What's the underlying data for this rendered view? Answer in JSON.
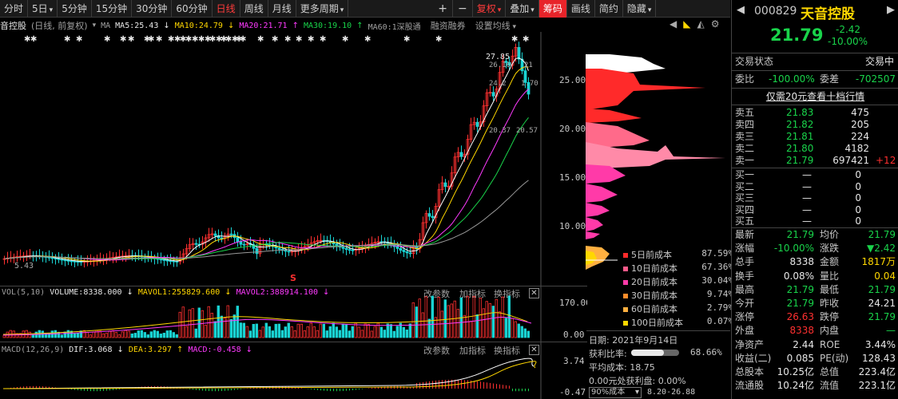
{
  "toolbar": {
    "items": [
      "分时",
      "5日",
      "5分钟",
      "15分钟",
      "30分钟",
      "60分钟",
      "日线",
      "周线",
      "月线",
      "更多周期"
    ],
    "active": "日线",
    "plus": "+",
    "minus": "−",
    "fuquan": "复权",
    "diejia": "叠加",
    "chouma": "筹码",
    "huaxian": "画线",
    "jianyue": "简约",
    "yincang": "隐藏",
    "nav_left": "◀",
    "nav_right": "▶"
  },
  "chart_header": {
    "name": "音控股",
    "mode": "(日线, 前复权)",
    "ma_label": "MA",
    "ma5": "MA5:25.43",
    "ma10": "MA10:24.79",
    "ma20": "MA20:21.71",
    "ma30": "MA30:19.10",
    "ma60": "MA60:1深股通",
    "rongzi": "融资融券",
    "settings": "设置均线"
  },
  "price_axis": [
    "25.00",
    "20.00",
    "15.00",
    "10.00"
  ],
  "price_annotations": {
    "high": "27.85",
    "a1": "26.16",
    "a2": "21",
    "a3": "24.2",
    "a4": "1.70",
    "a5": "20.37",
    "a6": "20.57",
    "low": "5.43",
    "s_marker": "S"
  },
  "volume_panel": {
    "label": "VOL(5,10)",
    "volume": "VOLUME:8338.000",
    "mavol1": "MAVOL1:255829.600",
    "mavol2": "MAVOL2:388914.100",
    "btn_params": "改参数",
    "btn_add": "加指标",
    "btn_switch": "换指标",
    "axis": [
      "170.00",
      "0.00"
    ]
  },
  "macd_panel": {
    "label": "MACD(12,26,9)",
    "dif": "DIF:3.068",
    "dea": "DEA:3.297",
    "macd": "MACD:-0.458",
    "btn_params": "改参数",
    "btn_add": "加指标",
    "btn_switch": "换指标",
    "axis": [
      "3.74",
      "-0.47"
    ]
  },
  "cost": {
    "legend": [
      {
        "label": "5日前成本",
        "pct": "87.59%",
        "color": "#ff2a2a"
      },
      {
        "label": "10日前成本",
        "pct": "67.36%",
        "color": "#ff5a8a"
      },
      {
        "label": "20日前成本",
        "pct": "30.04%",
        "color": "#ff3aa8"
      },
      {
        "label": "30日前成本",
        "pct": "9.74%",
        "color": "#ff8c2a"
      },
      {
        "label": "60日前成本",
        "pct": "2.79%",
        "color": "#ffb040"
      },
      {
        "label": "100日前成本",
        "pct": "0.07%",
        "color": "#ffd700"
      }
    ],
    "date_label": "日期: 2021年9月14日",
    "profit_label": "获利比率:",
    "profit_pct": "68.66%",
    "avg_label": "平均成本: 18.75",
    "profit_price": "0.00元处获利盘: 0.00%",
    "range_select": "90%成本",
    "range_value": "8.20-26.88"
  },
  "quote": {
    "code": "000829",
    "name": "天音控股",
    "price": "21.79",
    "change": "-2.42",
    "change_pct": "-10.00%",
    "status_label": "交易状态",
    "status_value": "交易中",
    "weibi_label": "委比",
    "weibi_value": "-100.00%",
    "weicha_label": "委差",
    "weicha_value": "-702507",
    "promo": "仅需20元查看十档行情",
    "sells": [
      {
        "label": "卖五",
        "price": "21.83",
        "vol": "475",
        "extra": ""
      },
      {
        "label": "卖四",
        "price": "21.82",
        "vol": "205",
        "extra": ""
      },
      {
        "label": "卖三",
        "price": "21.81",
        "vol": "224",
        "extra": ""
      },
      {
        "label": "卖二",
        "price": "21.80",
        "vol": "4182",
        "extra": ""
      },
      {
        "label": "卖一",
        "price": "21.79",
        "vol": "697421",
        "extra": "+12"
      }
    ],
    "buys": [
      {
        "label": "买一",
        "price": "—",
        "vol": "0"
      },
      {
        "label": "买二",
        "price": "—",
        "vol": "0"
      },
      {
        "label": "买三",
        "price": "—",
        "vol": "0"
      },
      {
        "label": "买四",
        "price": "—",
        "vol": "0"
      },
      {
        "label": "买五",
        "price": "—",
        "vol": "0"
      }
    ],
    "stats": [
      {
        "l1": "最新",
        "v1": "21.79",
        "c1": "green",
        "l2": "均价",
        "v2": "21.79",
        "c2": "green"
      },
      {
        "l1": "涨幅",
        "v1": "-10.00%",
        "c1": "green",
        "l2": "涨跌",
        "v2": "▼2.42",
        "c2": "green"
      },
      {
        "l1": "总手",
        "v1": "8338",
        "c1": "white",
        "l2": "金额",
        "v2": "1817万",
        "c2": "yellow"
      },
      {
        "l1": "换手",
        "v1": "0.08%",
        "c1": "white",
        "l2": "量比",
        "v2": "0.04",
        "c2": "yellow"
      },
      {
        "l1": "最高",
        "v1": "21.79",
        "c1": "green",
        "l2": "最低",
        "v2": "21.79",
        "c2": "green"
      },
      {
        "l1": "今开",
        "v1": "21.79",
        "c1": "green",
        "l2": "昨收",
        "v2": "24.21",
        "c2": "white"
      },
      {
        "l1": "涨停",
        "v1": "26.63",
        "c1": "red",
        "l2": "跌停",
        "v2": "21.79",
        "c2": "green"
      },
      {
        "l1": "外盘",
        "v1": "8338",
        "c1": "red",
        "l2": "内盘",
        "v2": "—",
        "c2": "green"
      },
      {
        "l1": "净资产",
        "v1": "2.44",
        "c1": "white",
        "l2": "ROE",
        "v2": "3.44%",
        "c2": "white"
      },
      {
        "l1": "收益(二)",
        "v1": "0.085",
        "c1": "white",
        "l2": "PE(动)",
        "v2": "128.43",
        "c2": "white"
      },
      {
        "l1": "总股本",
        "v1": "10.25亿",
        "c1": "white",
        "l2": "总值",
        "v2": "223.4亿",
        "c2": "white"
      },
      {
        "l1": "流通股",
        "v1": "10.24亿",
        "c1": "white",
        "l2": "流值",
        "v2": "223.1亿",
        "c2": "white"
      }
    ]
  },
  "colors": {
    "up": "#ff3030",
    "down": "#19d34a",
    "ma5": "#ffffff",
    "ma10": "#ffd700",
    "ma20": "#ff3aff",
    "ma30": "#19d34a",
    "ma60": "#9a9a9a"
  }
}
